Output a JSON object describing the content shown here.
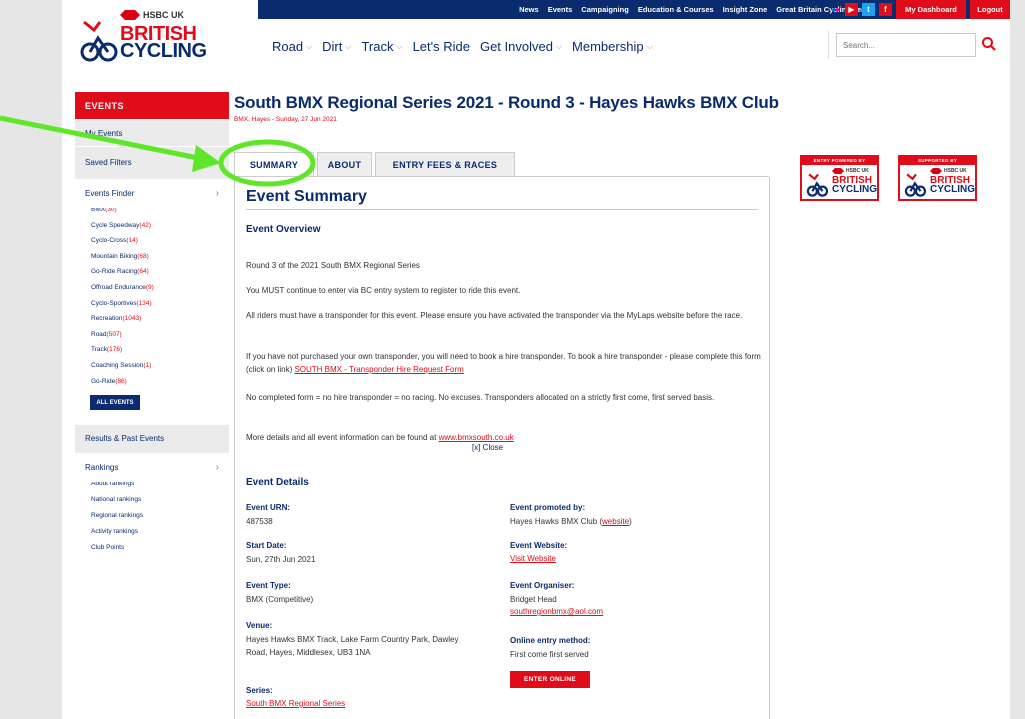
{
  "header": {
    "top_links": [
      "News",
      "Events",
      "Campaigning",
      "Education & Courses",
      "Insight Zone",
      "Great Britain Cycling Team"
    ],
    "dashboard_label": "My Dashboard",
    "logout_label": "Logout",
    "logo": {
      "hsbc": "HSBC UK",
      "line1": "BRITISH",
      "line2": "CYCLING"
    },
    "nav": [
      "Road",
      "Dirt",
      "Track",
      "Let's Ride",
      "Get Involved",
      "Membership"
    ],
    "search_placeholder": "Search..."
  },
  "sidebar": {
    "title": "EVENTS",
    "my_events": "My Events",
    "saved_filters": "Saved Filters",
    "events_finder": "Events Finder",
    "disciplines": [
      {
        "name": "BMX",
        "count": "(30)"
      },
      {
        "name": "Cycle Speedway",
        "count": "(42)"
      },
      {
        "name": "Cyclo-Cross",
        "count": "(14)"
      },
      {
        "name": "Mountain Biking",
        "count": "(68)"
      },
      {
        "name": "Go-Ride Racing",
        "count": "(64)"
      },
      {
        "name": "Offroad Endurance",
        "count": "(9)"
      },
      {
        "name": "Cyclo-Sportives",
        "count": "(134)"
      },
      {
        "name": "Recreation",
        "count": "(1043)"
      },
      {
        "name": "Road",
        "count": "(507)"
      },
      {
        "name": "Track",
        "count": "(176)"
      },
      {
        "name": "Coaching Session",
        "count": "(1)"
      },
      {
        "name": "Go-Ride",
        "count": "(86)"
      }
    ],
    "all_events": "ALL EVENTS",
    "results": "Results & Past Events",
    "rankings": "Rankings",
    "ranking_links": [
      "About rankings",
      "National rankings",
      "Regional rankings",
      "Activity rankings",
      "Club Points"
    ]
  },
  "event": {
    "title": "South BMX Regional Series 2021 - Round 3 - Hayes Hawks BMX Club",
    "subtitle": "BMX, Hayes - Sunday, 27 Jun 2021",
    "tabs": [
      "SUMMARY",
      "ABOUT",
      "ENTRY FEES & RACES"
    ],
    "summary_heading": "Event Summary",
    "overview_heading": "Event Overview",
    "para1": "Round 3 of the 2021 South BMX Regional Series",
    "para2": "You MUST continue to enter via BC entry system to register to ride this event.",
    "para3": "All riders must have a transponder for this event. Please ensure you have activated the transponder via the MyLaps website before the race.",
    "para4": "If you have not purchased your own transponder, you will need to book a hire transponder.  To book a hire transponder - please complete this form (click on link) ",
    "para4_link": "SOUTH BMX - Transponder Hire Request Form",
    "para5": "No completed form = no hire transponder = no racing.  No excuses. Transponders allocated on a strictly first come, first served basis.",
    "para6": "More details and all event information can be found at ",
    "para6_link": "www.bmxsouth.co.uk",
    "close_label": "[x] Close",
    "details_heading": "Event Details",
    "urn_label": "Event URN:",
    "urn_value": "487538",
    "start_label": "Start Date:",
    "start_value": "Sun, 27th Jun 2021",
    "type_label": "Event Type:",
    "type_value": "BMX (Competitive)",
    "venue_label": "Venue:",
    "venue_value": "Hayes Hawks BMX Track, Lake Farm Country Park, Dawley Road, Hayes, Middlesex, UB3 1NA",
    "series_label": "Series:",
    "series_value": "South BMX Regional Series",
    "promoted_label": "Event promoted by:",
    "promoted_value": "Hayes Hawks BMX Club (",
    "promoted_link": "website",
    "promoted_close": ")",
    "website_label": "Event Website:",
    "website_value": "Visit Website",
    "organiser_label": "Event Organiser:",
    "organiser_name": "Bridget Head",
    "organiser_email": "southregionbmx@aol.com",
    "entry_method_label": "Online entry method:",
    "entry_method_value": "First come first served",
    "enter_button": "ENTER ONLINE"
  },
  "badges": [
    {
      "top": "ENTRY POWERED BY",
      "hsbc": "HSBC UK",
      "line1": "BRITISH",
      "line2": "CYCLING"
    },
    {
      "top": "SUPPORTED BY",
      "hsbc": "HSBC UK",
      "line1": "BRITISH",
      "line2": "CYCLING"
    }
  ],
  "colors": {
    "navy": "#0a2b6e",
    "red": "#e00c1a",
    "annotation": "#5fe62a"
  }
}
